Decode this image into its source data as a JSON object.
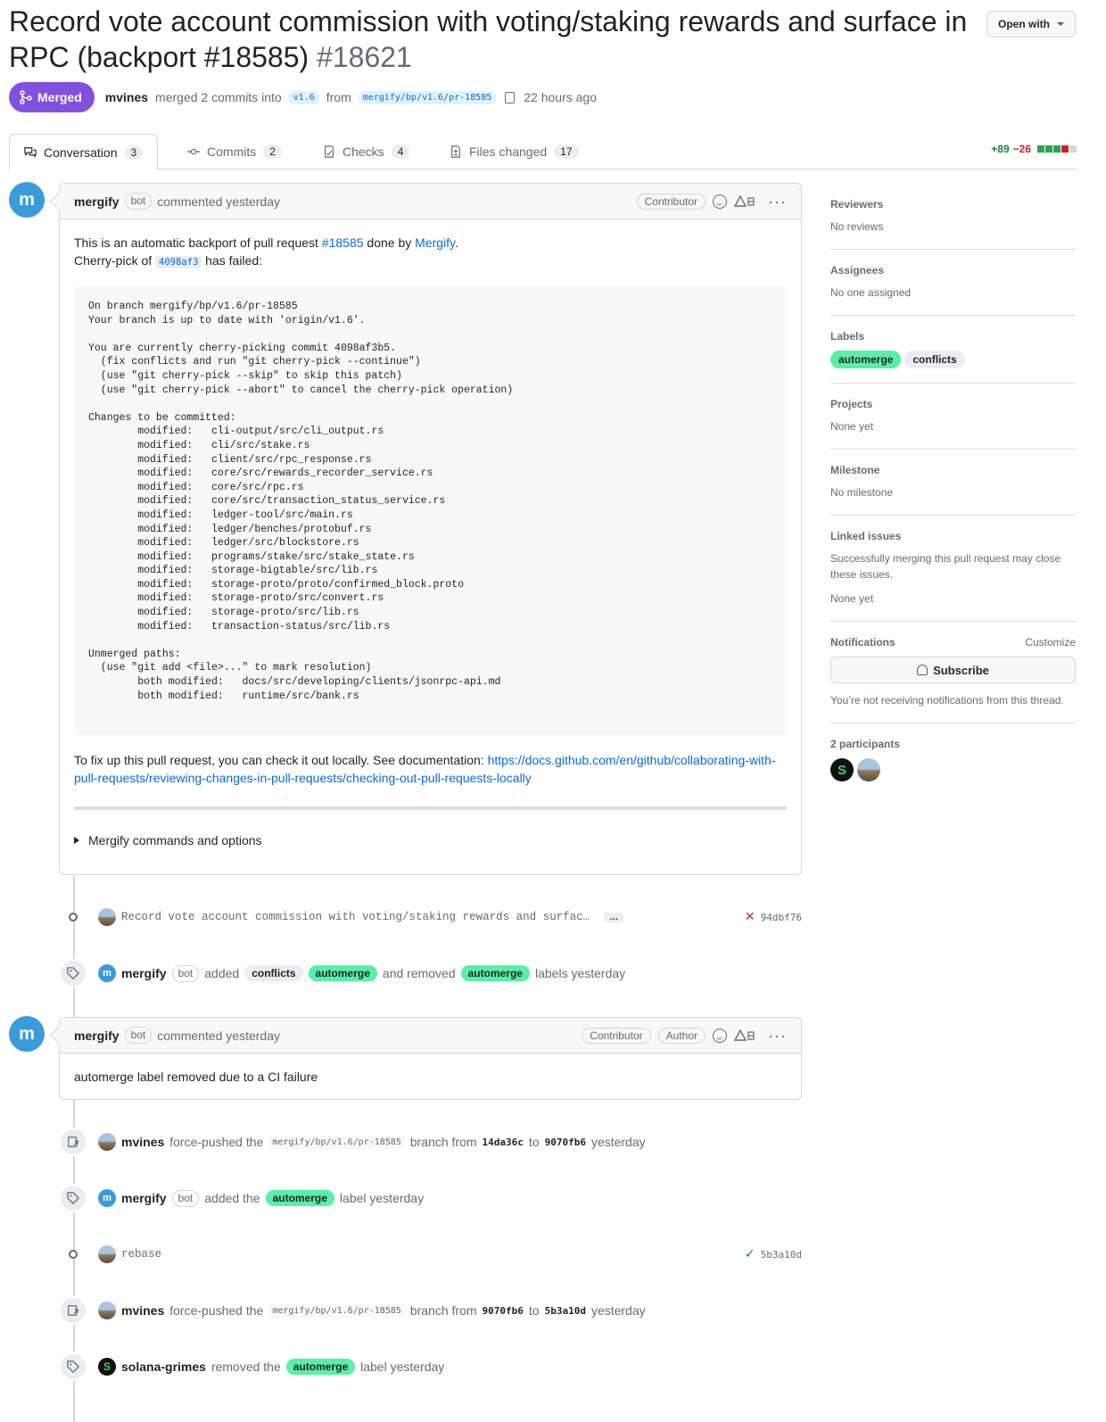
{
  "header": {
    "title": "Record vote account commission with voting/staking rewards and surface in RPC (backport #18585)",
    "number": "#18621",
    "open_with": "Open with",
    "state": "Merged",
    "author": "mvines",
    "merged_text": "merged 2 commits into",
    "base_branch": "v1.6",
    "from_text": "from",
    "head_branch": "mergify/bp/v1.6/pr-18585",
    "time": "22 hours ago"
  },
  "tabs": [
    {
      "label": "Conversation",
      "count": "3",
      "icon": "comment-discussion-icon"
    },
    {
      "label": "Commits",
      "count": "2",
      "icon": "git-commit-icon"
    },
    {
      "label": "Checks",
      "count": "4",
      "icon": "checklist-icon"
    },
    {
      "label": "Files changed",
      "count": "17",
      "icon": "file-diff-icon"
    }
  ],
  "diffstat": {
    "additions": "+89",
    "deletions": "−26",
    "colors": [
      "#2da44e",
      "#2da44e",
      "#2da44e",
      "#cf222e",
      "#d0d7de"
    ]
  },
  "comment1": {
    "author": "mergify",
    "bot": "bot",
    "action": "commented yesterday",
    "role": "Contributor",
    "line1_pre": "This is an automatic backport of pull request ",
    "line1_link": "#18585",
    "line1_mid": " done by ",
    "line1_link2": "Mergify",
    "line1_post": ".",
    "line2_pre": "Cherry-pick of ",
    "line2_sha": "4098af3",
    "line2_post": " has failed:",
    "code": "On branch mergify/bp/v1.6/pr-18585\nYour branch is up to date with 'origin/v1.6'.\n\nYou are currently cherry-picking commit 4098af3b5.\n  (fix conflicts and run \"git cherry-pick --continue\")\n  (use \"git cherry-pick --skip\" to skip this patch)\n  (use \"git cherry-pick --abort\" to cancel the cherry-pick operation)\n\nChanges to be committed:\n        modified:   cli-output/src/cli_output.rs\n        modified:   cli/src/stake.rs\n        modified:   client/src/rpc_response.rs\n        modified:   core/src/rewards_recorder_service.rs\n        modified:   core/src/rpc.rs\n        modified:   core/src/transaction_status_service.rs\n        modified:   ledger-tool/src/main.rs\n        modified:   ledger/benches/protobuf.rs\n        modified:   ledger/src/blockstore.rs\n        modified:   programs/stake/src/stake_state.rs\n        modified:   storage-bigtable/src/lib.rs\n        modified:   storage-proto/proto/confirmed_block.proto\n        modified:   storage-proto/src/convert.rs\n        modified:   storage-proto/src/lib.rs\n        modified:   transaction-status/src/lib.rs\n\nUnmerged paths:\n  (use \"git add <file>...\" to mark resolution)\n        both modified:   docs/src/developing/clients/jsonrpc-api.md\n        both modified:   runtime/src/bank.rs",
    "fix_text": "To fix up this pull request, you can check it out locally. See documentation: ",
    "fix_link": "https://docs.github.com/en/github/collaborating-with-pull-requests/reviewing-changes-in-pull-requests/checking-out-pull-requests-locally",
    "details": "Mergify commands and options"
  },
  "commit1": {
    "message": "Record vote account commission with voting/staking rewards and surfac…",
    "ellipsis": "…",
    "sha": "94dbf76",
    "status": "x"
  },
  "event1": {
    "author": "mergify",
    "bot": "bot",
    "added": "added",
    "label_a": "conflicts",
    "label_b": "automerge",
    "removed": "and removed",
    "label_c": "automerge",
    "tail": "labels yesterday"
  },
  "comment2": {
    "author": "mergify",
    "bot": "bot",
    "action": "commented yesterday",
    "role1": "Contributor",
    "role2": "Author",
    "body": "automerge label removed due to a CI failure"
  },
  "event2": {
    "author": "mvines",
    "text": "force-pushed the",
    "branch": "mergify/bp/v1.6/pr-18585",
    "mid": "branch from",
    "from": "14da36c",
    "to_text": "to",
    "to": "9070fb6",
    "tail": "yesterday"
  },
  "event3": {
    "author": "mergify",
    "bot": "bot",
    "text": "added the",
    "label": "automerge",
    "tail": "label yesterday"
  },
  "commit2": {
    "message": "rebase",
    "sha": "5b3a10d",
    "status": "check"
  },
  "event4": {
    "author": "mvines",
    "text": "force-pushed the",
    "branch": "mergify/bp/v1.6/pr-18585",
    "mid": "branch from",
    "from": "9070fb6",
    "to_text": "to",
    "to": "5b3a10d",
    "tail": "yesterday"
  },
  "event5": {
    "author": "solana-grimes",
    "text": "removed the",
    "label": "automerge",
    "tail": "label yesterday"
  },
  "sidebar": {
    "reviewers": {
      "title": "Reviewers",
      "value": "No reviews"
    },
    "assignees": {
      "title": "Assignees",
      "value": "No one assigned"
    },
    "labels": {
      "title": "Labels",
      "items": [
        "automerge",
        "conflicts"
      ]
    },
    "projects": {
      "title": "Projects",
      "value": "None yet"
    },
    "milestone": {
      "title": "Milestone",
      "value": "No milestone"
    },
    "linked": {
      "title": "Linked issues",
      "desc": "Successfully merging this pull request may close these issues.",
      "value": "None yet"
    },
    "notifications": {
      "title": "Notifications",
      "customize": "Customize",
      "button": "Subscribe",
      "desc": "You’re not receiving notifications from this thread."
    },
    "participants": {
      "title": "2 participants"
    }
  }
}
